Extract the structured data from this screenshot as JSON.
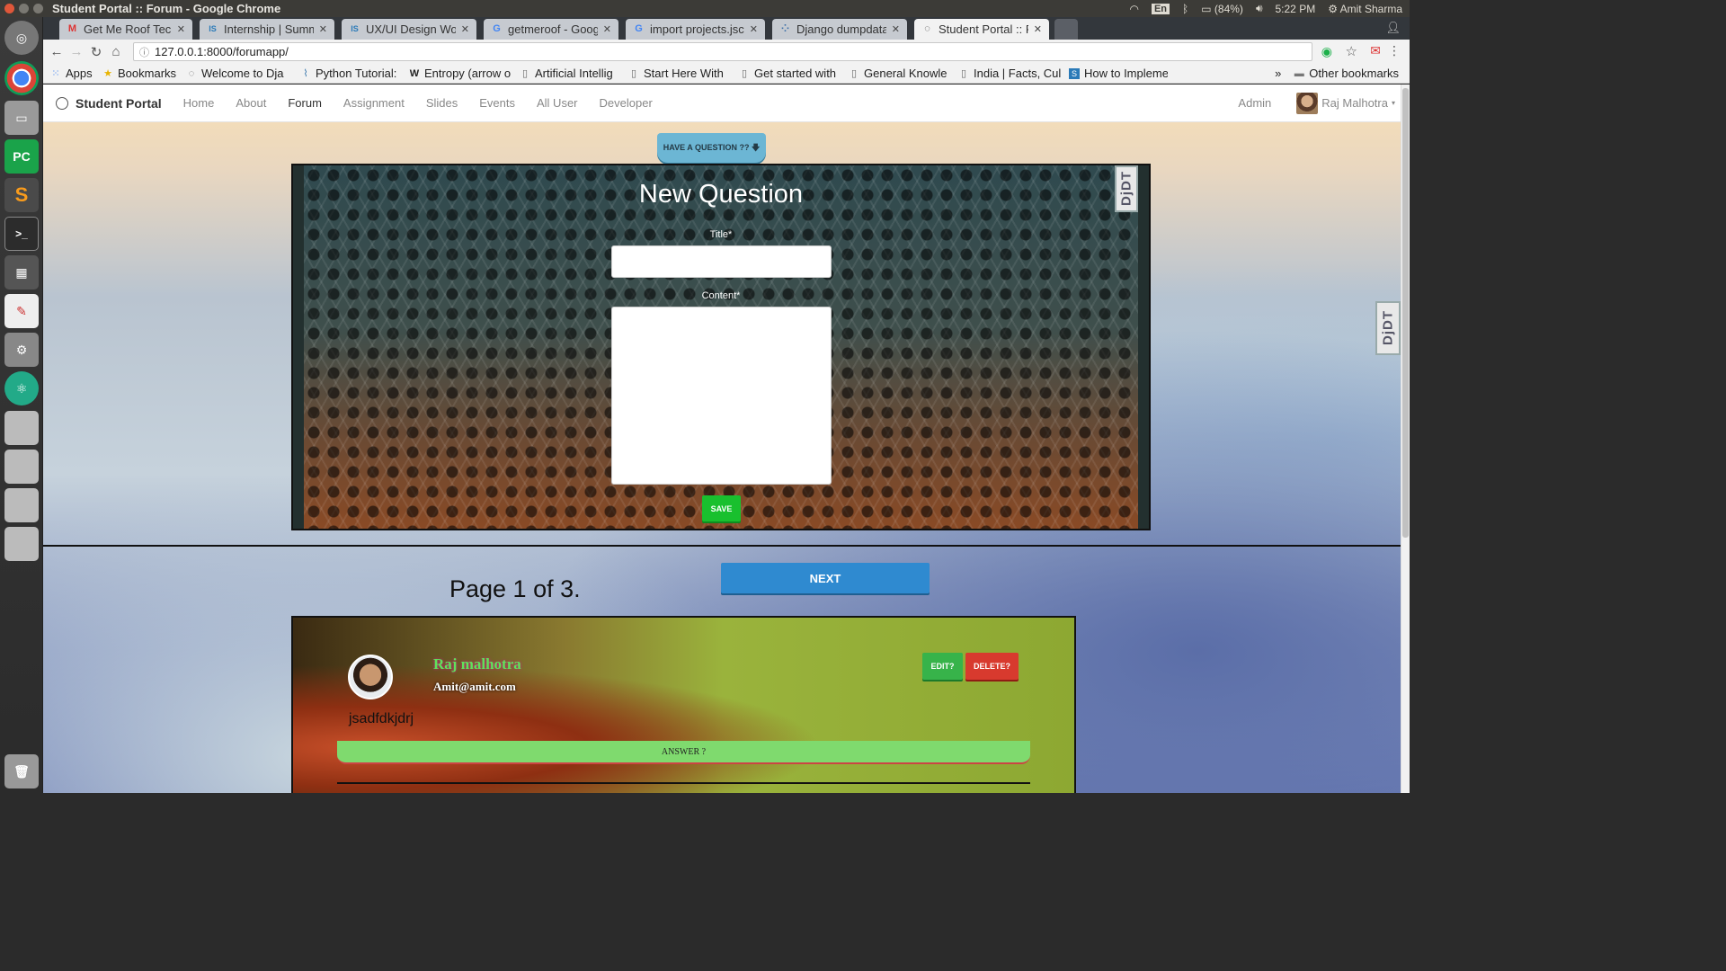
{
  "os": {
    "window_title": "Student Portal :: Forum - Google Chrome",
    "lang": "En",
    "battery": "(84%)",
    "time": "5:22 PM",
    "user": "Amit Sharma"
  },
  "launcher": {
    "items": [
      "ubuntu-dash-icon",
      "chrome-icon",
      "files-icon",
      "pycharm-icon",
      "sublime-icon",
      "terminal-icon",
      "workspace-icon",
      "text-editor-icon",
      "settings-icon",
      "atom-icon",
      "drive-icon",
      "drive-icon",
      "drive-icon",
      "drive-icon",
      "trash-icon"
    ],
    "pycharm_label": "PC",
    "sublime_label": "S",
    "terminal_label": ">_"
  },
  "tabs": [
    {
      "title": "Get Me Roof Tech A",
      "favicon": "M"
    },
    {
      "title": "Internship | Summe",
      "favicon": "IS"
    },
    {
      "title": "UX/UI Design Work",
      "favicon": "IS"
    },
    {
      "title": "getmeroof - Googl",
      "favicon": "G"
    },
    {
      "title": "import projects.jsc",
      "favicon": "G"
    },
    {
      "title": "Django dumpdata",
      "favicon": "⁘"
    },
    {
      "title": "Student Portal :: Fo",
      "favicon": "◌"
    }
  ],
  "toolbar": {
    "url": "127.0.0.1:8000/forumapp/",
    "url_host": "127.0.0.1",
    "url_rest": ":8000/forumapp/"
  },
  "bookmarks": {
    "items": [
      {
        "label": "Apps",
        "icon": "apps-grid-icon"
      },
      {
        "label": "Bookmarks",
        "icon": "star-icon"
      },
      {
        "label": "Welcome to Dja",
        "icon": "globe-icon"
      },
      {
        "label": "Python Tutorial:",
        "icon": "python-icon"
      },
      {
        "label": "Entropy (arrow o",
        "icon": "wikipedia-icon"
      },
      {
        "label": "Artificial Intellig",
        "icon": "page-icon"
      },
      {
        "label": "Start Here With",
        "icon": "page-icon"
      },
      {
        "label": "Get started with",
        "icon": "page-icon"
      },
      {
        "label": "General Knowle",
        "icon": "page-icon"
      },
      {
        "label": "India | Facts, Cul",
        "icon": "page-icon"
      },
      {
        "label": "How to Impleme",
        "icon": "s-icon"
      }
    ],
    "overflow": "»",
    "other": "Other bookmarks"
  },
  "site": {
    "brand": "Student Portal",
    "nav": [
      "Home",
      "About",
      "Forum",
      "Assignment",
      "Slides",
      "Events",
      "All User",
      "Developer"
    ],
    "active_nav": "Forum",
    "admin": "Admin",
    "user": "Raj Malhotra"
  },
  "ask_tab": "HAVE A QUESTION ?? 🡇",
  "form": {
    "heading": "New Question",
    "title_label": "Title*",
    "content_label": "Content*",
    "title_value": "",
    "content_value": "",
    "save": "SAVE"
  },
  "djdt_label": "DjDT",
  "pagination": {
    "info": "Page 1 of 3.",
    "next": "NEXT"
  },
  "question": {
    "author": "Raj malhotra",
    "email": "Amit@amit.com",
    "text": "jsadfdkjdrj",
    "edit": "EDIT?",
    "delete": "DELETE?",
    "answer": "ANSWER ?"
  }
}
